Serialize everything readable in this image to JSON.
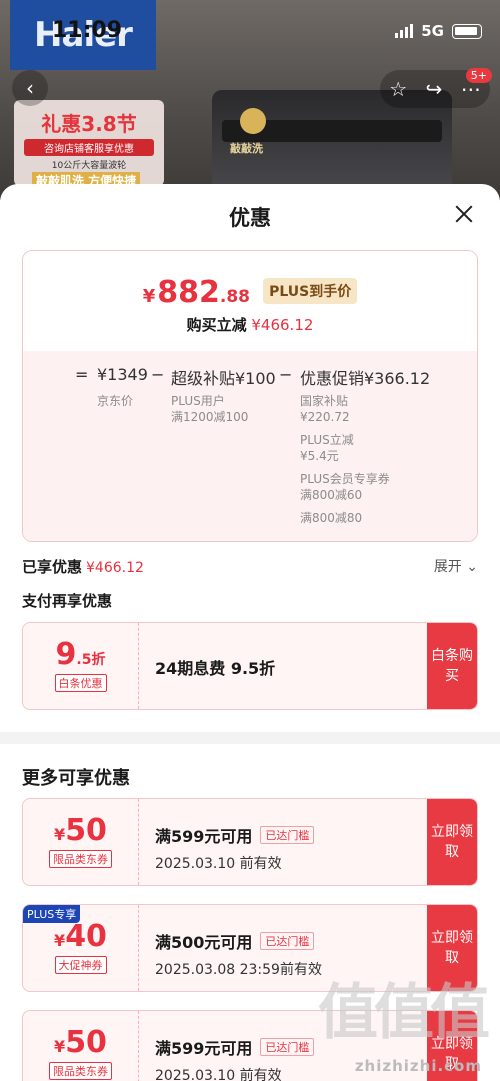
{
  "status_bar": {
    "time": "11:09",
    "network": "5G"
  },
  "backdrop": {
    "brand": "Haier",
    "promo_title": "礼惠3.8节",
    "promo_sub": "咨询店铺客服享优惠",
    "promo_sub2": "10公斤大容量波轮",
    "promo_strip": "敲敲肌洗 方便快捷",
    "washer_label": "敲敲洗",
    "notification_badge": "5+"
  },
  "sheet": {
    "title": "优惠",
    "price": {
      "currency": "¥",
      "integer": "882",
      "decimal": ".88",
      "plus_badge": "PLUS到手价",
      "reduce_label": "购买立减",
      "reduce_value": "¥466.12"
    },
    "formula": {
      "eq": "=",
      "jd_price": "¥1349",
      "jd_price_label": "京东价",
      "minus1": "−",
      "super_subsidy": "超级补贴¥100",
      "super_sub_1": "PLUS用户",
      "super_sub_2": "满1200减100",
      "minus2": "−",
      "promo": "优惠促销¥366.12",
      "promo_sub": [
        "国家补贴",
        "¥220.72",
        "PLUS立减",
        "¥5.4元",
        "PLUS会员专享券",
        "满800减60",
        "满800减80"
      ]
    },
    "enjoyed_label": "已享优惠",
    "enjoyed_value": "¥466.12",
    "expand_label": "展开",
    "pay_more_label": "支付再享优惠",
    "baitiao": {
      "discount_num": "9",
      "discount_dec": ".5折",
      "tag": "白条优惠",
      "desc": "24期息费 9.5折",
      "button": "白条购买"
    },
    "more_title": "更多可享优惠",
    "coupons": [
      {
        "currency": "¥",
        "amount": "50",
        "tag": "限品类东券",
        "condition": "满599元可用",
        "reached": "已达门槛",
        "expiry": "2025.03.10 前有效",
        "button": "立即领取",
        "plus": ""
      },
      {
        "currency": "¥",
        "amount": "40",
        "tag": "大促神券",
        "condition": "满500元可用",
        "reached": "已达门槛",
        "expiry": "2025.03.08 23:59前有效",
        "button": "立即领取",
        "plus": "PLUS专享"
      },
      {
        "currency": "¥",
        "amount": "50",
        "tag": "限品类东券",
        "condition": "满599元可用",
        "reached": "已达门槛",
        "expiry": "2025.03.10 前有效",
        "button": "立即领取",
        "plus": ""
      }
    ]
  },
  "watermark": {
    "big": "值值值",
    "site": "zhizhizhi.com"
  }
}
